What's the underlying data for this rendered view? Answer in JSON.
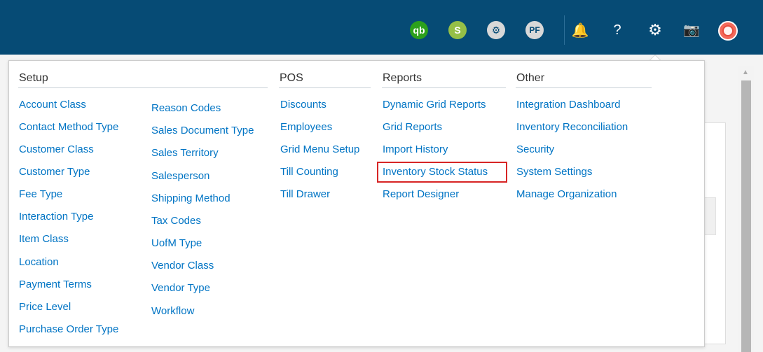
{
  "header": {
    "icons": [
      {
        "name": "quickbooks-icon",
        "label": "qb"
      },
      {
        "name": "shopify-icon",
        "label": "S"
      },
      {
        "name": "settings-badge-icon",
        "label": "⚙"
      },
      {
        "name": "pf-icon",
        "label": "PF"
      },
      {
        "name": "bell-icon",
        "label": "🔔"
      },
      {
        "name": "help-icon",
        "label": "?"
      },
      {
        "name": "gear-icon",
        "label": "⚙"
      },
      {
        "name": "camera-icon",
        "label": "📷"
      },
      {
        "name": "avatar-icon",
        "label": ""
      }
    ]
  },
  "menu": {
    "setup": {
      "title": "Setup",
      "col1": [
        "Account Class",
        "Contact Method Type",
        "Customer Class",
        "Customer Type",
        "Fee Type",
        "Interaction Type",
        "Item Class",
        "Location",
        "Payment Terms",
        "Price Level",
        "Purchase Order Type"
      ],
      "col2": [
        "Reason Codes",
        "Sales Document Type",
        "Sales Territory",
        "Salesperson",
        "Shipping Method",
        "Tax Codes",
        "UofM Type",
        "Vendor Class",
        "Vendor Type",
        "Workflow"
      ]
    },
    "pos": {
      "title": "POS",
      "items": [
        "Discounts",
        "Employees",
        "Grid Menu Setup",
        "Till Counting",
        "Till Drawer"
      ]
    },
    "reports": {
      "title": "Reports",
      "items": [
        "Dynamic Grid Reports",
        "Grid Reports",
        "Import History",
        "Inventory Stock Status",
        "Report Designer"
      ]
    },
    "other": {
      "title": "Other",
      "items": [
        "Integration Dashboard",
        "Inventory Reconciliation",
        "Security",
        "System Settings",
        "Manage Organization"
      ]
    }
  },
  "colors": {
    "topbar": "#064b75",
    "link": "#0074c4",
    "highlight": "#d72525"
  }
}
